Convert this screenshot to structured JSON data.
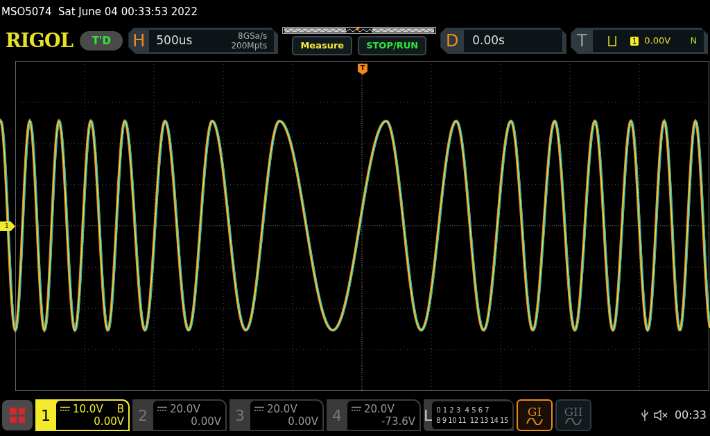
{
  "header": {
    "title": "MSO5074  Sat June 04 00:33:53 2022"
  },
  "toolbar": {
    "logo": "RIGOL",
    "mode_badge": "T'D",
    "horizontal": {
      "letter": "H",
      "timebase": "500us",
      "sample_rate": "8GSa/s",
      "memory_depth": "200Mpts"
    },
    "buttons": [
      {
        "label": "Measure",
        "kind": "measure"
      },
      {
        "label": "STOP/RUN",
        "kind": "run"
      }
    ],
    "delay": {
      "letter": "D",
      "value": "0.00s"
    },
    "trigger": {
      "letter": "T",
      "source": "1",
      "level": "0.00V",
      "mode": "N"
    }
  },
  "display": {
    "trigger_marker": "T",
    "channel_marker": "1"
  },
  "channels": [
    {
      "number": "1",
      "scale": "10.0V",
      "bandwidth_limit": "B",
      "offset": "0.00V",
      "selected": true
    },
    {
      "number": "2",
      "scale": "20.0V",
      "offset": "0.00V",
      "selected": false
    },
    {
      "number": "3",
      "scale": "20.0V",
      "offset": "0.00V",
      "selected": false
    },
    {
      "number": "4",
      "scale": "20.0V",
      "offset": "-73.6V",
      "selected": false
    }
  ],
  "logic": {
    "letter": "L",
    "row_1": [
      "0 1 2 3",
      "4 5 6 7"
    ],
    "row_2": [
      "8 9 10 11",
      "12 13 14 15"
    ]
  },
  "generators": [
    {
      "label": "GI",
      "selected": true
    },
    {
      "label": "GII",
      "selected": false
    }
  ],
  "status": {
    "time": "00:33"
  }
}
